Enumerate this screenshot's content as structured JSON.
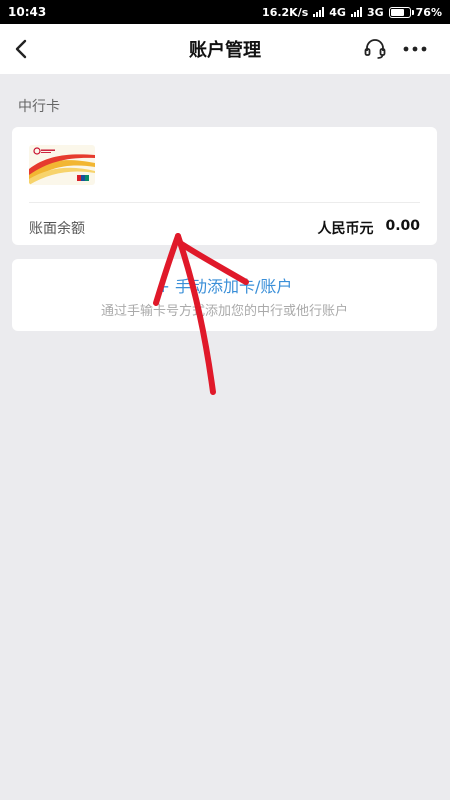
{
  "status_bar": {
    "time": "10:43",
    "speed": "16.2K/s",
    "network_1": "4G",
    "network_2": "3G",
    "battery_text": "76%",
    "battery_level": 0.76
  },
  "nav": {
    "title": "账户管理",
    "back_icon": "chevron-left-icon",
    "service_icon": "headset-icon",
    "more_icon": "more-dots-icon"
  },
  "section": {
    "label": "中行卡"
  },
  "card": {
    "balance_label": "账面余额",
    "currency": "人民币元",
    "amount": "0.00"
  },
  "add_account": {
    "title": "+ 手动添加卡/账户",
    "subtitle": "通过手输卡号方式添加您的中行或他行账户"
  },
  "colors": {
    "accent": "#3a8fd8",
    "background": "#ebebee",
    "annotation": "#e0192a"
  }
}
